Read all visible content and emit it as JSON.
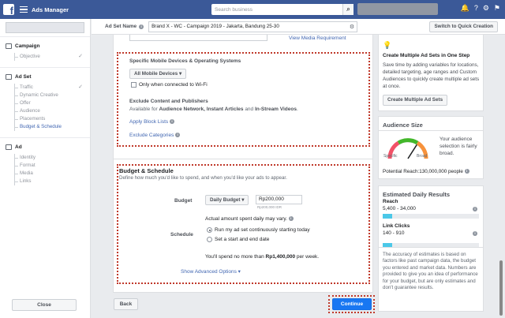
{
  "topbar": {
    "app_name": "Ads Manager",
    "search_placeholder": "Search business"
  },
  "sidebar": {
    "campaign": {
      "title": "Campaign",
      "items": [
        {
          "label": "Objective",
          "done": "✓"
        }
      ]
    },
    "adset": {
      "title": "Ad Set",
      "items": [
        {
          "label": "Traffic",
          "done": "✓"
        },
        {
          "label": "Dynamic Creative"
        },
        {
          "label": "Offer"
        },
        {
          "label": "Audience"
        },
        {
          "label": "Placements"
        },
        {
          "label": "Budget & Schedule"
        }
      ]
    },
    "ad": {
      "title": "Ad",
      "items": [
        {
          "label": "Identity"
        },
        {
          "label": "Format"
        },
        {
          "label": "Media"
        },
        {
          "label": "Links"
        }
      ]
    },
    "close": "Close"
  },
  "header": {
    "label": "Ad Set Name",
    "value": "Brand X - WC - Campaign 2019 - Jakarta, Bandung 25-30",
    "switch": "Switch to Quick Creation"
  },
  "placements": {
    "view_media": "View Media Requirement",
    "devices_title": "Specific Mobile Devices & Operating Systems",
    "devices_select": "All Mobile Devices",
    "wifi": "Only when connected to Wi-Fi",
    "exclude_title": "Exclude Content and Publishers",
    "exclude_desc_prefix": "Available for ",
    "exclude_desc_bold": "Audience Network, Instant Articles",
    "exclude_desc_mid": " and ",
    "exclude_desc_bold2": "In-Stream Videos",
    "exclude_desc_end": ".",
    "block_lists": "Apply Block Lists",
    "exclude_categories": "Exclude Categories"
  },
  "budget": {
    "title": "Budget & Schedule",
    "desc": "Define how much you'd like to spend, and when you'd like your ads to appear.",
    "budget_label": "Budget",
    "budget_type": "Daily Budget",
    "amount": "Rp200,000",
    "amount_sub": "Rp200,000 IDR",
    "actual": "Actual amount spent daily may vary.",
    "schedule_label": "Schedule",
    "opt1": "Run my ad set continuously starting today",
    "opt2": "Set a start and end date",
    "spend_prefix": "You'll spend no more than ",
    "spend_amount": "Rp1,400,000",
    "spend_suffix": " per week.",
    "advanced": "Show Advanced Options"
  },
  "footer": {
    "back": "Back",
    "continue": "Continue"
  },
  "tip": {
    "title": "Create Multiple Ad Sets in One Step",
    "body": "Save time by adding variables for locations, detailed targeting, age ranges and Custom Audiences to quickly create multiple ad sets at once.",
    "button": "Create Multiple Ad Sets"
  },
  "audience": {
    "title": "Audience Size",
    "desc": "Your audience selection is fairly broad.",
    "specific": "Specific",
    "broad": "Broad",
    "reach_label": "Potential Reach:",
    "reach_value": "130,000,000 people",
    "gauge_level": 0.68
  },
  "results": {
    "title": "Estimated Daily Results",
    "reach_label": "Reach",
    "reach_value": "5,400 - 34,000",
    "reach_fill": 0.1,
    "clicks_label": "Link Clicks",
    "clicks_value": "140 - 910",
    "clicks_fill": 0.1,
    "note": "The accuracy of estimates is based on factors like past campaign data, the budget you entered and market data. Numbers are provided to give you an idea of performance for your budget, but are only estimates and don't guarantee results."
  },
  "colors": {
    "brand": "#3b5998",
    "link": "#4267b2",
    "continue": "#1877f2",
    "highlight": "#c0392b"
  }
}
